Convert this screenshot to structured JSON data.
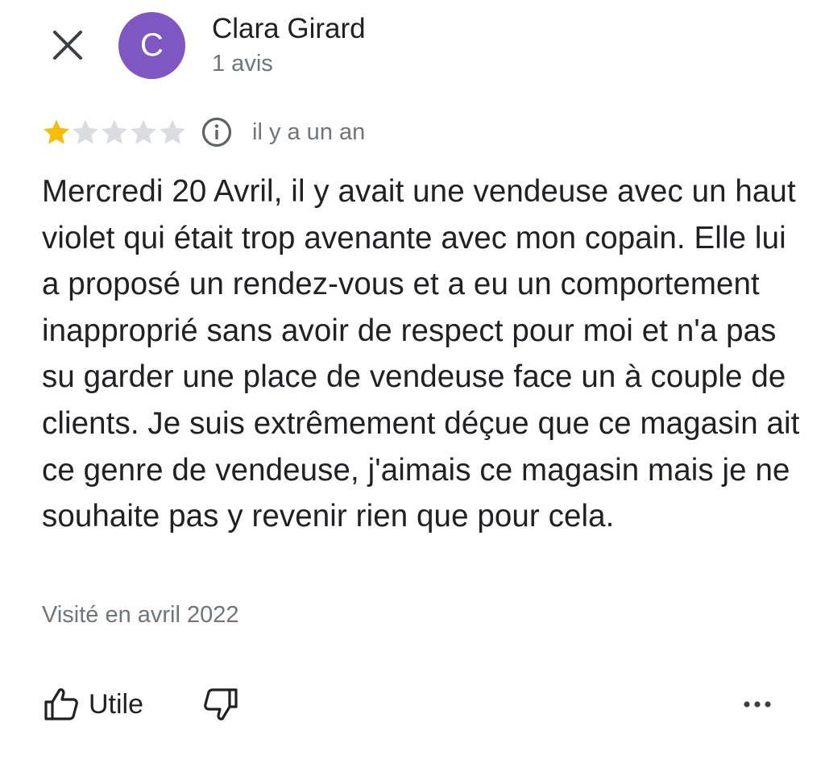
{
  "colors": {
    "avatar_bg": "#7e57c2",
    "star_filled": "#fbbc04",
    "star_empty": "#dadce0",
    "text_primary": "#202124",
    "text_secondary": "#70757a"
  },
  "header": {
    "close_icon": "close-icon",
    "avatar_letter": "C",
    "reviewer_name": "Clara Girard",
    "review_count": "1 avis"
  },
  "review": {
    "rating": 1,
    "rating_max": 5,
    "info_icon": "info-icon",
    "date": "il y a un an",
    "text": "Mercredi 20 Avril, il y avait une vendeuse avec un haut violet qui était trop avenante avec mon copain. Elle lui a proposé un rendez-vous et a eu un comportement inapproprié sans avoir de respect pour moi et n'a pas su garder une place de vendeuse face un à couple de clients. Je suis extrêmement déçue que ce magasin ait ce genre de vendeuse, j'aimais ce magasin mais je ne souhaite pas y revenir rien que pour cela.",
    "visited": "Visité en avril 2022"
  },
  "actions": {
    "useful_label": "Utile",
    "like_icon": "thumbs-up-icon",
    "dislike_icon": "thumbs-down-icon",
    "more_icon": "more-horizontal-icon"
  }
}
